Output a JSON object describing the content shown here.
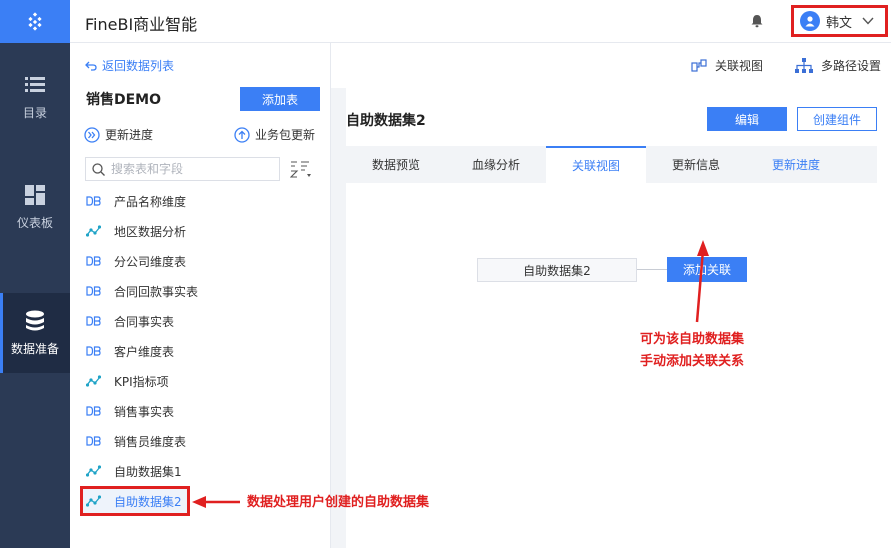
{
  "header": {
    "app_title": "FineBI商业智能",
    "user_name": "韩文"
  },
  "nav": {
    "items": [
      {
        "label": "目录"
      },
      {
        "label": "仪表板"
      },
      {
        "label": "数据准备"
      }
    ]
  },
  "left": {
    "back_link": "返回数据列表",
    "package_title": "销售DEMO",
    "add_table_button": "添加表",
    "update_progress": "更新进度",
    "package_update": "业务包更新",
    "search_placeholder": "搜索表和字段",
    "tables": [
      {
        "label": "产品名称维度",
        "icon": "db-table-icon"
      },
      {
        "label": "地区数据分析",
        "icon": "self-dataset-icon"
      },
      {
        "label": "分公司维度表",
        "icon": "db-table-icon"
      },
      {
        "label": "合同回款事实表",
        "icon": "db-table-icon"
      },
      {
        "label": "合同事实表",
        "icon": "db-table-icon"
      },
      {
        "label": "客户维度表",
        "icon": "db-table-icon"
      },
      {
        "label": "KPI指标项",
        "icon": "self-dataset-icon"
      },
      {
        "label": "销售事实表",
        "icon": "db-table-icon"
      },
      {
        "label": "销售员维度表",
        "icon": "db-table-icon"
      },
      {
        "label": "自助数据集1",
        "icon": "self-dataset-icon"
      },
      {
        "label": "自助数据集2",
        "icon": "self-dataset-icon"
      }
    ]
  },
  "toolbar": {
    "relation_view": "关联视图",
    "multipath_settings": "多路径设置"
  },
  "main": {
    "dataset_title": "自助数据集2",
    "edit_button": "编辑",
    "create_component_button": "创建组件",
    "tabs": [
      {
        "label": "数据预览"
      },
      {
        "label": "血缘分析"
      },
      {
        "label": "关联视图"
      },
      {
        "label": "更新信息"
      },
      {
        "label": "更新进度"
      }
    ],
    "relation_node": "自助数据集2",
    "add_relation_button": "添加关联"
  },
  "annotations": {
    "right_line1": "可为该自助数据集",
    "right_line2": "手动添加关联关系",
    "bottom": "数据处理用户创建的自助数据集"
  },
  "colors": {
    "accent": "#3b7ff5",
    "nav_bg": "#2b3a55",
    "annotation_red": "#e02020"
  }
}
